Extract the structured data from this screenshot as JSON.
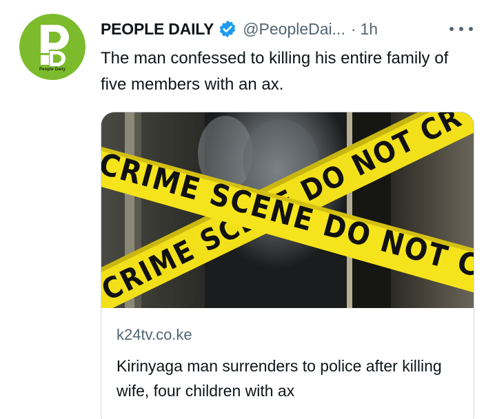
{
  "tweet": {
    "avatar_caption": "People Daily",
    "display_name": "PEOPLE DAILY",
    "handle": "@PeopleDai...",
    "separator": "·",
    "time": "1h",
    "text": "The man confessed to killing his entire family of five members with an ax."
  },
  "card": {
    "tape_texts": [
      "CRIME SCENE DO NOT CR",
      "CRIME SCENE DO NOT CR"
    ],
    "domain": "k24tv.co.ke",
    "title": "Kirinyaga man surrenders to police after killing wife, four children with ax"
  },
  "colors": {
    "brand_green": "#7cbc2c",
    "verified_blue": "#1d9bf0",
    "tape_yellow": "#f2e01a",
    "secondary_text": "#536471"
  },
  "icons": {
    "verified": "verified-badge-icon",
    "more": "more-options-icon"
  }
}
